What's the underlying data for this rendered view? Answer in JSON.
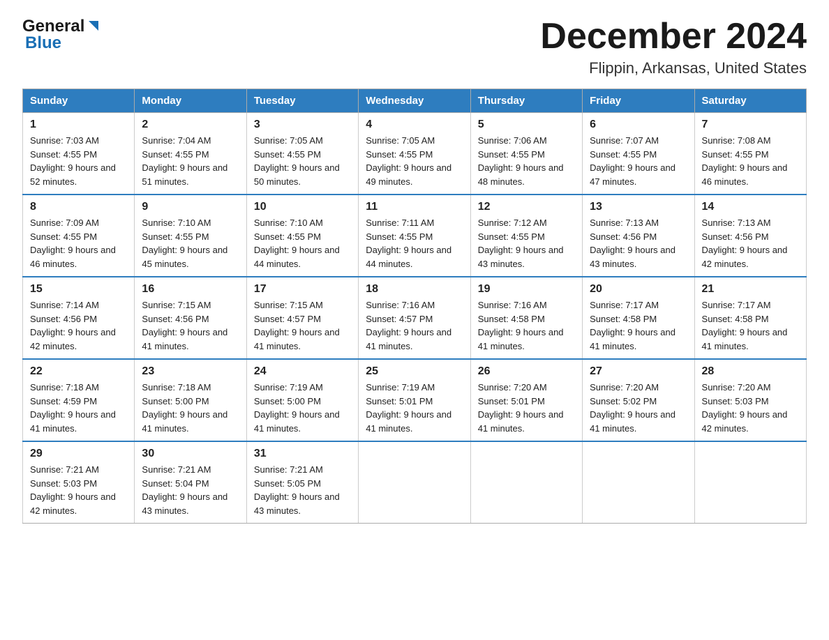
{
  "header": {
    "logo_general": "General",
    "logo_blue": "Blue",
    "title": "December 2024",
    "subtitle": "Flippin, Arkansas, United States"
  },
  "calendar": {
    "days_of_week": [
      "Sunday",
      "Monday",
      "Tuesday",
      "Wednesday",
      "Thursday",
      "Friday",
      "Saturday"
    ],
    "weeks": [
      [
        {
          "day": "1",
          "sunrise": "7:03 AM",
          "sunset": "4:55 PM",
          "daylight": "9 hours and 52 minutes."
        },
        {
          "day": "2",
          "sunrise": "7:04 AM",
          "sunset": "4:55 PM",
          "daylight": "9 hours and 51 minutes."
        },
        {
          "day": "3",
          "sunrise": "7:05 AM",
          "sunset": "4:55 PM",
          "daylight": "9 hours and 50 minutes."
        },
        {
          "day": "4",
          "sunrise": "7:05 AM",
          "sunset": "4:55 PM",
          "daylight": "9 hours and 49 minutes."
        },
        {
          "day": "5",
          "sunrise": "7:06 AM",
          "sunset": "4:55 PM",
          "daylight": "9 hours and 48 minutes."
        },
        {
          "day": "6",
          "sunrise": "7:07 AM",
          "sunset": "4:55 PM",
          "daylight": "9 hours and 47 minutes."
        },
        {
          "day": "7",
          "sunrise": "7:08 AM",
          "sunset": "4:55 PM",
          "daylight": "9 hours and 46 minutes."
        }
      ],
      [
        {
          "day": "8",
          "sunrise": "7:09 AM",
          "sunset": "4:55 PM",
          "daylight": "9 hours and 46 minutes."
        },
        {
          "day": "9",
          "sunrise": "7:10 AM",
          "sunset": "4:55 PM",
          "daylight": "9 hours and 45 minutes."
        },
        {
          "day": "10",
          "sunrise": "7:10 AM",
          "sunset": "4:55 PM",
          "daylight": "9 hours and 44 minutes."
        },
        {
          "day": "11",
          "sunrise": "7:11 AM",
          "sunset": "4:55 PM",
          "daylight": "9 hours and 44 minutes."
        },
        {
          "day": "12",
          "sunrise": "7:12 AM",
          "sunset": "4:55 PM",
          "daylight": "9 hours and 43 minutes."
        },
        {
          "day": "13",
          "sunrise": "7:13 AM",
          "sunset": "4:56 PM",
          "daylight": "9 hours and 43 minutes."
        },
        {
          "day": "14",
          "sunrise": "7:13 AM",
          "sunset": "4:56 PM",
          "daylight": "9 hours and 42 minutes."
        }
      ],
      [
        {
          "day": "15",
          "sunrise": "7:14 AM",
          "sunset": "4:56 PM",
          "daylight": "9 hours and 42 minutes."
        },
        {
          "day": "16",
          "sunrise": "7:15 AM",
          "sunset": "4:56 PM",
          "daylight": "9 hours and 41 minutes."
        },
        {
          "day": "17",
          "sunrise": "7:15 AM",
          "sunset": "4:57 PM",
          "daylight": "9 hours and 41 minutes."
        },
        {
          "day": "18",
          "sunrise": "7:16 AM",
          "sunset": "4:57 PM",
          "daylight": "9 hours and 41 minutes."
        },
        {
          "day": "19",
          "sunrise": "7:16 AM",
          "sunset": "4:58 PM",
          "daylight": "9 hours and 41 minutes."
        },
        {
          "day": "20",
          "sunrise": "7:17 AM",
          "sunset": "4:58 PM",
          "daylight": "9 hours and 41 minutes."
        },
        {
          "day": "21",
          "sunrise": "7:17 AM",
          "sunset": "4:58 PM",
          "daylight": "9 hours and 41 minutes."
        }
      ],
      [
        {
          "day": "22",
          "sunrise": "7:18 AM",
          "sunset": "4:59 PM",
          "daylight": "9 hours and 41 minutes."
        },
        {
          "day": "23",
          "sunrise": "7:18 AM",
          "sunset": "5:00 PM",
          "daylight": "9 hours and 41 minutes."
        },
        {
          "day": "24",
          "sunrise": "7:19 AM",
          "sunset": "5:00 PM",
          "daylight": "9 hours and 41 minutes."
        },
        {
          "day": "25",
          "sunrise": "7:19 AM",
          "sunset": "5:01 PM",
          "daylight": "9 hours and 41 minutes."
        },
        {
          "day": "26",
          "sunrise": "7:20 AM",
          "sunset": "5:01 PM",
          "daylight": "9 hours and 41 minutes."
        },
        {
          "day": "27",
          "sunrise": "7:20 AM",
          "sunset": "5:02 PM",
          "daylight": "9 hours and 41 minutes."
        },
        {
          "day": "28",
          "sunrise": "7:20 AM",
          "sunset": "5:03 PM",
          "daylight": "9 hours and 42 minutes."
        }
      ],
      [
        {
          "day": "29",
          "sunrise": "7:21 AM",
          "sunset": "5:03 PM",
          "daylight": "9 hours and 42 minutes."
        },
        {
          "day": "30",
          "sunrise": "7:21 AM",
          "sunset": "5:04 PM",
          "daylight": "9 hours and 43 minutes."
        },
        {
          "day": "31",
          "sunrise": "7:21 AM",
          "sunset": "5:05 PM",
          "daylight": "9 hours and 43 minutes."
        },
        null,
        null,
        null,
        null
      ]
    ]
  }
}
